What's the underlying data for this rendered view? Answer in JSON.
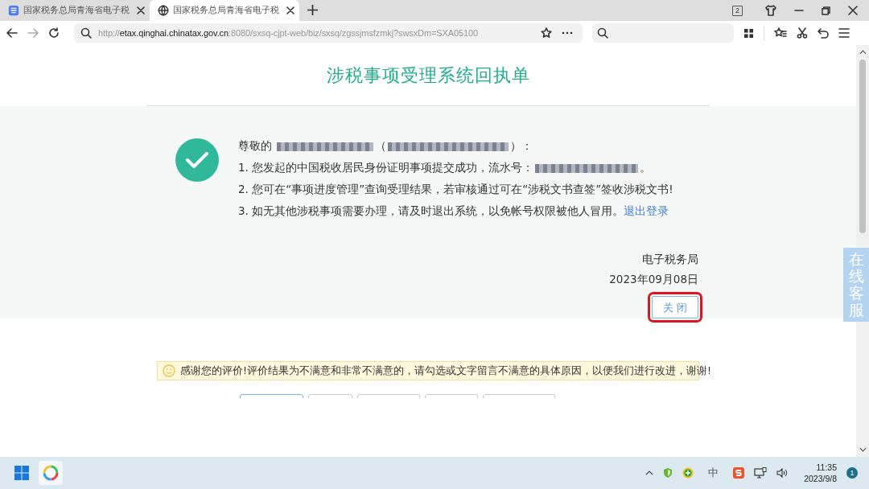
{
  "browser": {
    "tabs": [
      {
        "title": "国家税务总局青海省电子税",
        "selected": false
      },
      {
        "title": "国家税务总局青海省电子税",
        "selected": true
      }
    ],
    "tab_count": "2",
    "address": {
      "scheme": "http://",
      "host": "etax.qinghai.chinatax.gov.cn",
      "path": ":8080/sxsq-cjpt-web/biz/sxsq/zgssjmsfzmkj?swsxDm=SXA05100"
    }
  },
  "receipt": {
    "title": "涉税事项受理系统回执单",
    "greeting": {
      "prefix": "尊敬的",
      "open": "（",
      "close": "）："
    },
    "lines": [
      {
        "text": "1. 您发起的中国税收居民身份证明事项提交成功，流水号：",
        "suffix": "。",
        "kind": "redacted"
      },
      {
        "text": "2. 您可在“事项进度管理”查询受理结果，若审核通过可在“涉税文书查签”签收涉税文书!",
        "kind": "plain"
      },
      {
        "text": "3. 如无其他涉税事项需要办理，请及时退出系统，以免帐号权限被他人冒用。",
        "link": "退出登录",
        "kind": "link"
      }
    ],
    "issuer": "电子税务局",
    "date": "2023年09月08日",
    "close_button": "关 闭"
  },
  "feedback": {
    "notice": "感谢您的评价!评价结果为不满意和非常不满意的，请勾选或文字留言不满意的具体原因，以便我们进行改进，谢谢!",
    "options": [
      {
        "selected": true
      },
      {
        "selected": false
      },
      {
        "selected": false
      },
      {
        "selected": false
      },
      {
        "selected": false
      }
    ]
  },
  "service_tab": "在线客服",
  "taskbar": {
    "ime": "中",
    "time": "11:35",
    "date": "2023/9/8",
    "notifications": "1"
  }
}
